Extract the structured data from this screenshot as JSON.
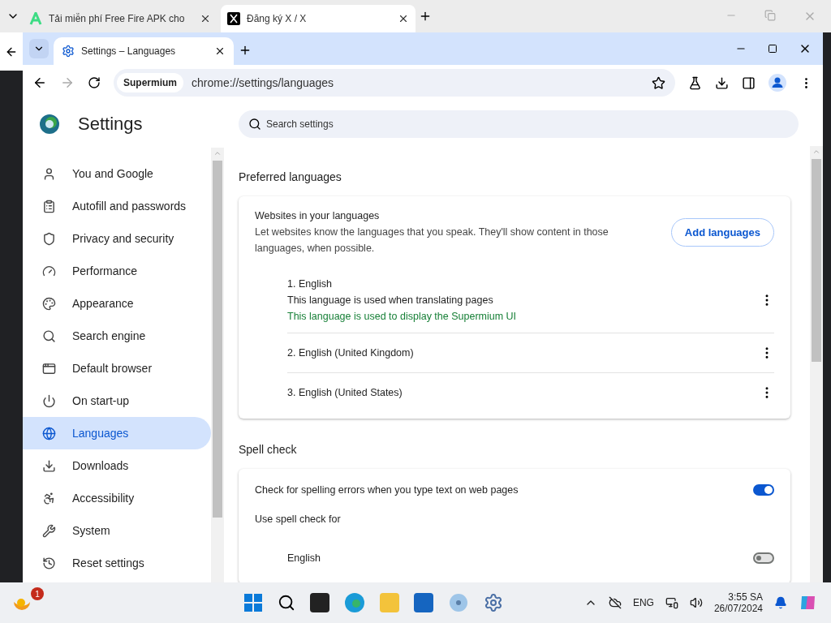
{
  "outer_tabs": [
    {
      "title": "Tải miễn phí Free Fire APK cho",
      "selected": false
    },
    {
      "title": "Đăng ký X / X",
      "selected": true
    }
  ],
  "window": {
    "tabs": [
      {
        "title": "Settings – Languages",
        "selected": true
      }
    ],
    "address": {
      "chip": "Supermium",
      "url": "chrome://settings/languages"
    }
  },
  "sidebar": {
    "title": "Settings",
    "items": [
      {
        "label": "You and Google",
        "selected": false
      },
      {
        "label": "Autofill and passwords",
        "selected": false
      },
      {
        "label": "Privacy and security",
        "selected": false
      },
      {
        "label": "Performance",
        "selected": false
      },
      {
        "label": "Appearance",
        "selected": false
      },
      {
        "label": "Search engine",
        "selected": false
      },
      {
        "label": "Default browser",
        "selected": false
      },
      {
        "label": "On start-up",
        "selected": false
      },
      {
        "label": "Languages",
        "selected": true
      },
      {
        "label": "Downloads",
        "selected": false
      },
      {
        "label": "Accessibility",
        "selected": false
      },
      {
        "label": "System",
        "selected": false
      },
      {
        "label": "Reset settings",
        "selected": false
      }
    ]
  },
  "search": {
    "placeholder": "Search settings"
  },
  "preferred_languages": {
    "heading": "Preferred languages",
    "card_title": "Websites in your languages",
    "description": "Let websites know the languages that you speak. They'll show content in those languages, when possible.",
    "button": "Add languages",
    "languages": [
      {
        "name": "1. English",
        "notes": [
          "This language is used when translating pages"
        ],
        "ui_note": "This language is used to display the Supermium UI"
      },
      {
        "name": "2. English (United Kingdom)"
      },
      {
        "name": "3. English (United States)"
      }
    ]
  },
  "spell_check": {
    "heading": "Spell check",
    "toggle_label": "Check for spelling errors when you type text on web pages",
    "on": true,
    "use_for": "Use spell check for",
    "languages": [
      {
        "name": "English",
        "on": false
      }
    ]
  },
  "taskbar": {
    "badge": "1",
    "lang": "ENG",
    "time": "3:55 SA",
    "date": "26/07/2024"
  }
}
